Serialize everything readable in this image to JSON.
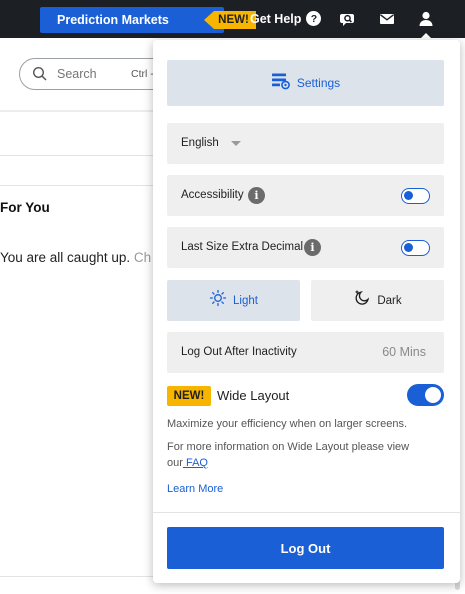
{
  "topbar": {
    "prediction_markets_label": "Prediction Markets",
    "new_badge": "NEW!",
    "get_help_label": "Get Help",
    "help_icon_glyph": "?",
    "icons": [
      "chat-search-icon",
      "mail-icon",
      "user-icon"
    ]
  },
  "background": {
    "search": {
      "placeholder": "Search",
      "shortcut": "Ctrl -"
    },
    "for_you_heading": "For You",
    "caught_up_text": "You are all caught up.",
    "caught_up_fade": "Ch"
  },
  "panel": {
    "settings_label": "Settings",
    "language_value": "English",
    "accessibility_label": "Accessibility",
    "accessibility_on": false,
    "last_size_label": "Last Size Extra Decimal",
    "last_size_on": false,
    "info_glyph": "i",
    "theme": {
      "light_label": "Light",
      "dark_label": "Dark",
      "selected": "Light"
    },
    "inactivity_label": "Log Out After Inactivity",
    "inactivity_value": "60 Mins",
    "wide_layout": {
      "badge": "NEW!",
      "title": "Wide Layout",
      "enabled": true,
      "desc": "Maximize your efficiency when on larger screens.",
      "info_line1": "For more information on Wide Layout please view",
      "info_line2_prefix": "our",
      "faq_link": " FAQ",
      "learn_more": "Learn More"
    },
    "logout_label": "Log Out"
  },
  "colors": {
    "accent": "#1a5fd6",
    "topbar_bg": "#1c1f24",
    "badge_yellow": "#f7b500",
    "row_bg": "#efefef",
    "selected_bg": "#dde3eb"
  }
}
